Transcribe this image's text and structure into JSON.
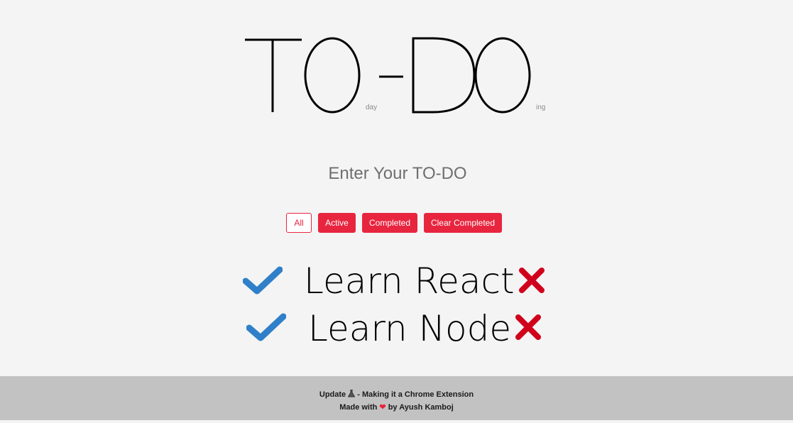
{
  "header": {
    "title_left": "TO",
    "title_right": "DO",
    "sub_left": "day",
    "sub_right": "ing"
  },
  "input": {
    "placeholder": "Enter Your TO-DO"
  },
  "filters": {
    "all": "All",
    "active": "Active",
    "completed": "Completed",
    "clear_completed": "Clear Completed",
    "selected": "All"
  },
  "todos": [
    {
      "text": "Learn React",
      "check_icon": "check-icon",
      "delete_icon": "cross-icon"
    },
    {
      "text": "Learn Node",
      "check_icon": "check-icon",
      "delete_icon": "cross-icon"
    }
  ],
  "footer": {
    "line1_prefix": "Update",
    "line1_icon": "flask-icon",
    "line1_suffix": "- Making it a Chrome Extension",
    "line2_prefix": "Made with",
    "line2_icon": "heart-icon",
    "line2_suffix": "by Ayush Kamboj"
  },
  "colors": {
    "accent": "#e8253f",
    "check": "#2f80c8",
    "cross": "#d0021b",
    "background": "#f4f4f4",
    "footer_bg": "#c2c2c2"
  }
}
